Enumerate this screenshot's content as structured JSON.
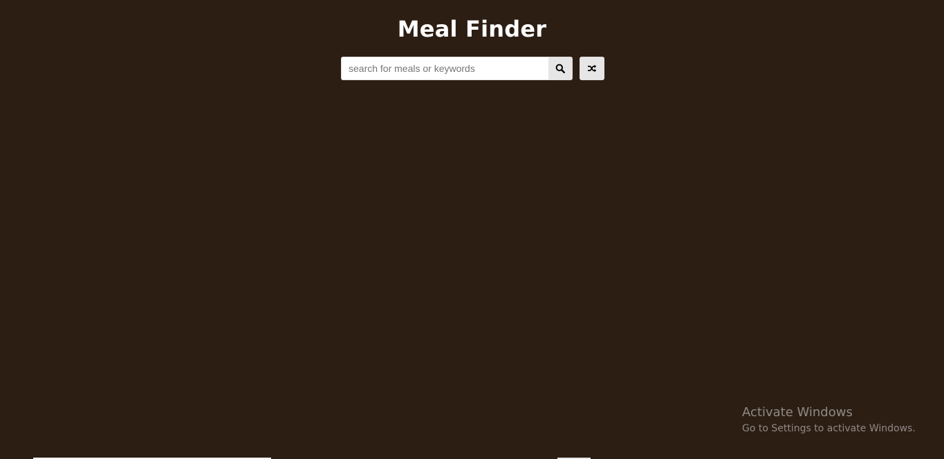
{
  "header": {
    "title": "Meal Finder"
  },
  "search": {
    "placeholder": "search for meals or keywords",
    "value": "",
    "submit_icon": "search-icon",
    "random_icon": "shuffle-icon"
  },
  "watermark": {
    "title": "Activate Windows",
    "subtitle": "Go to Settings to activate Windows."
  },
  "colors": {
    "background": "#2d1e13",
    "title": "#ffffff",
    "button": "#e6e6e6"
  }
}
